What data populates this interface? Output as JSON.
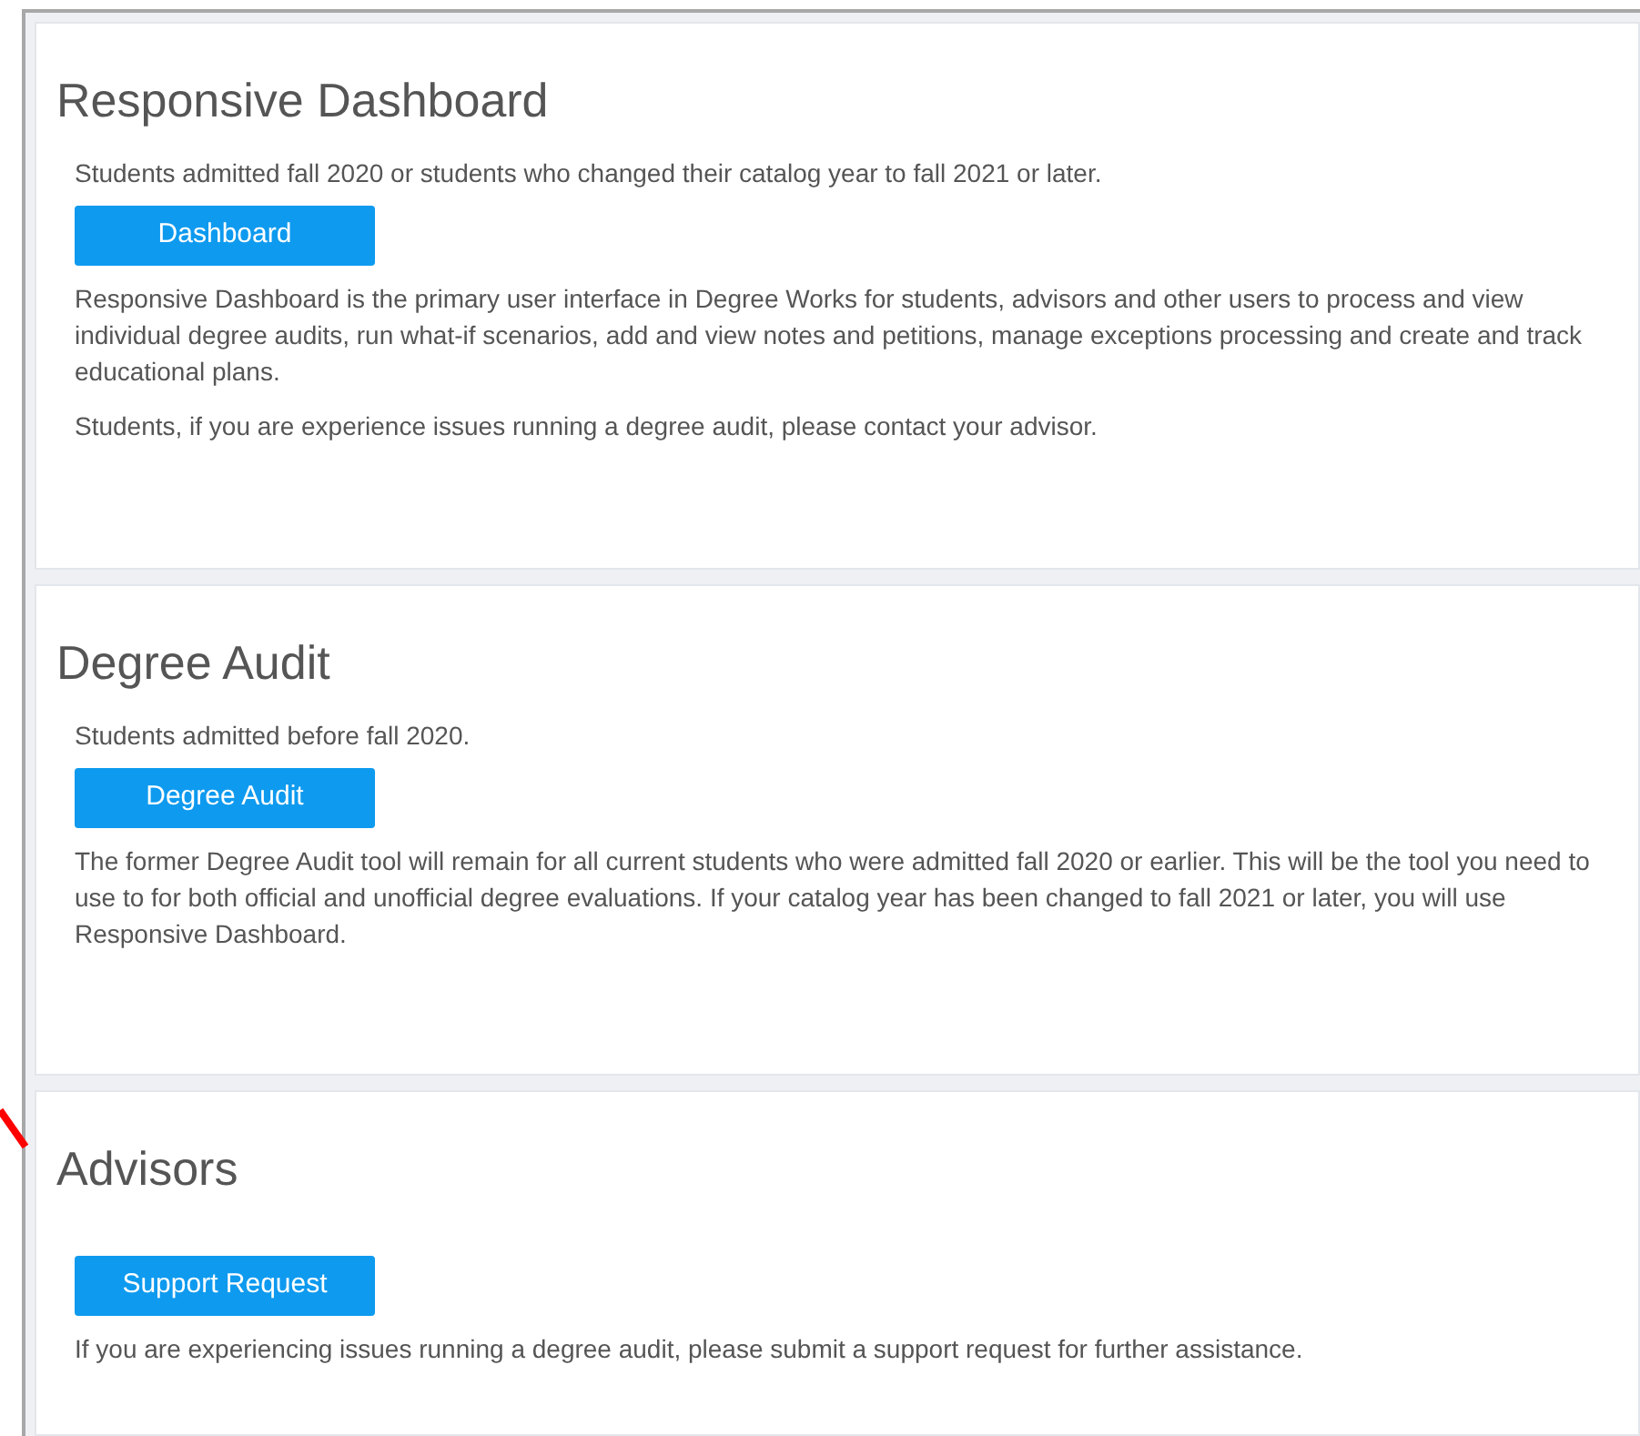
{
  "sections": [
    {
      "title": "Responsive Dashboard",
      "intro": "Students admitted fall 2020 or students who changed their catalog year to fall 2021 or later.",
      "button": "Dashboard",
      "paragraphs": [
        "Responsive Dashboard is the primary user interface in Degree Works for students, advisors and other users to process and view individual degree audits, run what-if scenarios, add and view notes and petitions, manage exceptions processing and create and track educational plans.",
        "Students, if you are experience issues running a degree audit, please contact your advisor."
      ]
    },
    {
      "title": "Degree Audit",
      "intro": "Students admitted before fall 2020.",
      "button": "Degree Audit",
      "paragraphs": [
        "The former Degree Audit tool will remain for all current students who were admitted fall 2020 or earlier. This will be the tool you need to use to for both official and unofficial degree evaluations. If your catalog year has been changed to fall 2021 or later, you will use Responsive Dashboard."
      ]
    },
    {
      "title": "Advisors",
      "button": "Support Request",
      "paragraphs": [
        "If you are experiencing issues running a degree audit, please submit a support request for further assistance."
      ]
    }
  ]
}
